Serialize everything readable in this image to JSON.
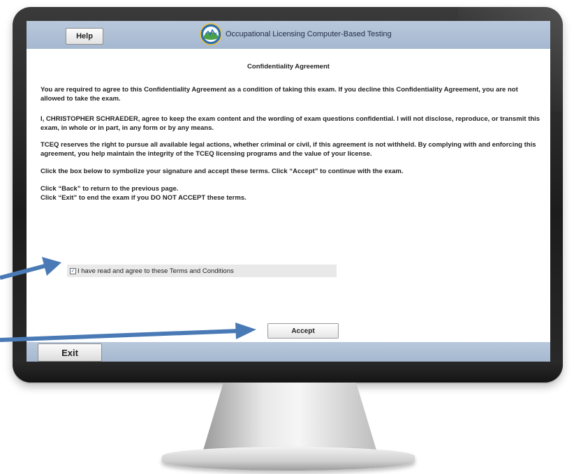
{
  "header": {
    "help_label": "Help",
    "app_title": "Occupational Licensing Computer-Based Testing"
  },
  "document": {
    "title": "Confidentiality Agreement",
    "paragraphs": [
      "You are required to agree to this Confidentiality Agreement as a condition of taking this exam.  If you decline this Confidentiality Agreement, you are not allowed to take the exam.",
      "I, CHRISTOPHER SCHRAEDER, agree to keep the exam content and the wording of exam questions confidential.  I will not disclose, reproduce, or transmit this exam, in whole or in part, in any form or by any means.",
      "TCEQ reserves the right to pursue all available legal actions, whether criminal or civil, if this agreement is not withheld.  By complying with and enforcing this agreement, you help maintain the integrity of the TCEQ licensing programs and the value of your license.",
      "Click the box below to symbolize your signature and accept these terms.  Click “Accept” to continue with the exam.",
      "Click “Back” to return to the previous page."
    ],
    "exit_line": "Click “Exit” to end the exam if you DO NOT ACCEPT these terms."
  },
  "agreement": {
    "checked": true,
    "label": "I have read and agree to these Terms and Conditions"
  },
  "accept_label": "Accept",
  "footer": {
    "exit_label": "Exit"
  },
  "colors": {
    "bar": "#a5b8d0",
    "arrow": "#4a7ab5"
  }
}
